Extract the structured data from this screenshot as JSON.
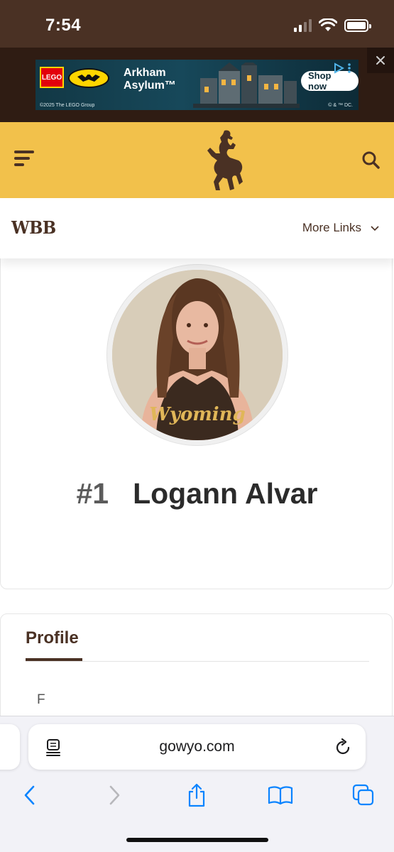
{
  "status_bar": {
    "time": "7:54"
  },
  "ad": {
    "brand": "LEGO",
    "title": "Arkham Asylum™",
    "cta": "Shop now",
    "copyright": "©2025 The LEGO Group",
    "legal": "© & ™ DC."
  },
  "site": {
    "sport": "WBB",
    "more_links": "More Links"
  },
  "player": {
    "number": "#1",
    "name": "Logann Alvar",
    "jersey_text": "Wyoming"
  },
  "profile": {
    "tab": "Profile",
    "position": "F"
  },
  "browser": {
    "url": "gowyo.com"
  },
  "colors": {
    "brown": "#4a3124",
    "gold": "#f2c14b",
    "ios_blue": "#0a84ff"
  }
}
